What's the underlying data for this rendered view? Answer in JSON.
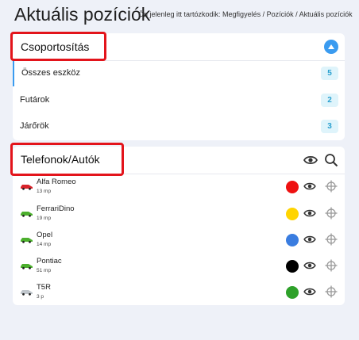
{
  "page": {
    "title": "Aktuális pozíciók",
    "breadcrumb": "Ön jelenleg itt tartózkodik: Megfigyelés / Pozíciók / Aktuális pozíciók"
  },
  "grouping": {
    "title": "Csoportosítás",
    "items": [
      {
        "label": "Összes eszköz",
        "count": "5"
      },
      {
        "label": "Futárok",
        "count": "2"
      },
      {
        "label": "Járőrök",
        "count": "3"
      }
    ]
  },
  "phones": {
    "title": "Telefonok/Autók",
    "vehicles": [
      {
        "name": "Alfa Romeo",
        "meta": "13 mp",
        "car_color": "#d8232a",
        "dot_color": "#ee1111"
      },
      {
        "name": "FerrariDino",
        "meta": "19 mp",
        "car_color": "#4caf2d",
        "dot_color": "#ffd400"
      },
      {
        "name": "Opel",
        "meta": "14 mp",
        "car_color": "#4caf2d",
        "dot_color": "#3a7de0"
      },
      {
        "name": "Pontiac",
        "meta": "51 mp",
        "car_color": "#4caf2d",
        "dot_color": "#000000"
      },
      {
        "name": "T5R",
        "meta": "3 p",
        "car_color": "#c0c6cc",
        "dot_color": "#2ea12a"
      }
    ]
  },
  "colors": {
    "accent": "#3a9bf0",
    "highlight_box": "#e3141b",
    "badge_bg": "#dff4fb",
    "badge_text": "#2aa0cf"
  }
}
